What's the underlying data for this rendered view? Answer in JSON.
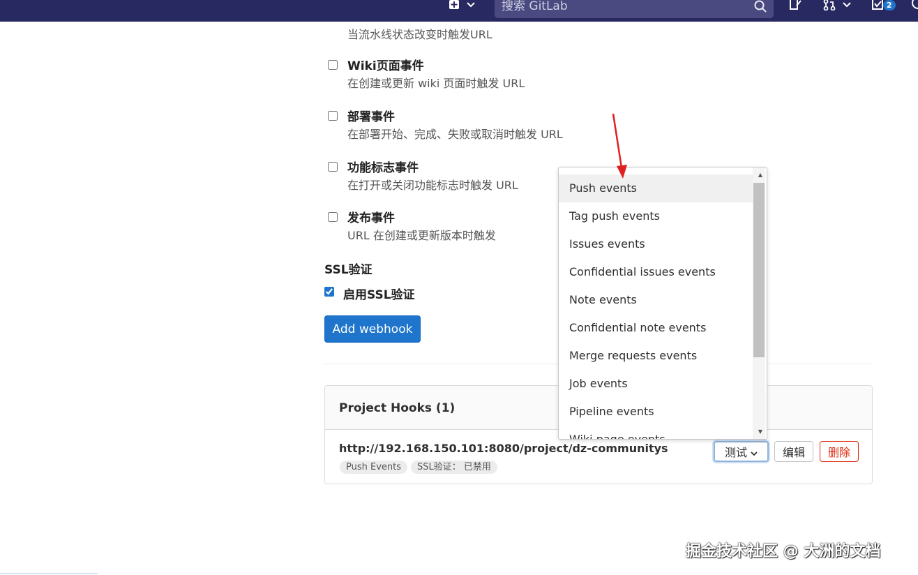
{
  "topbar": {
    "search_placeholder": "搜索 GitLab",
    "todo_count": "2"
  },
  "events": {
    "top_description": "当流水线状态改变时触发URL",
    "items": [
      {
        "title": "Wiki页面事件",
        "description": "在创建或更新 wiki 页面时触发 URL",
        "checked": false
      },
      {
        "title": "部署事件",
        "description": "在部署开始、完成、失败或取消时触发 URL",
        "checked": false
      },
      {
        "title": "功能标志事件",
        "description": "在打开或关闭功能标志时触发 URL",
        "checked": false
      },
      {
        "title": "发布事件",
        "description": "URL 在创建或更新版本时触发",
        "checked": false
      }
    ]
  },
  "ssl": {
    "heading": "SSL验证",
    "enable_label": "启用SSL验证",
    "enabled": true
  },
  "add_webhook_label": "Add webhook",
  "hooks": {
    "title": "Project Hooks (1)",
    "url": "http://192.168.150.101:8080/project/dz-communitys",
    "tags": [
      "Push Events",
      "SSL验证： 已禁用"
    ],
    "test_label": "测试",
    "edit_label": "编辑",
    "delete_label": "删除"
  },
  "test_dropdown": {
    "items": [
      "Push events",
      "Tag push events",
      "Issues events",
      "Confidential issues events",
      "Note events",
      "Confidential note events",
      "Merge requests events",
      "Job events",
      "Pipeline events",
      "Wiki page events"
    ],
    "active_index": 0
  },
  "watermark": "掘金技术社区 @ 大洲的文档",
  "colors": {
    "topbar": "#292961",
    "primary": "#1f75cb",
    "danger": "#dd2b0e",
    "annotation_arrow": "#e02020"
  }
}
